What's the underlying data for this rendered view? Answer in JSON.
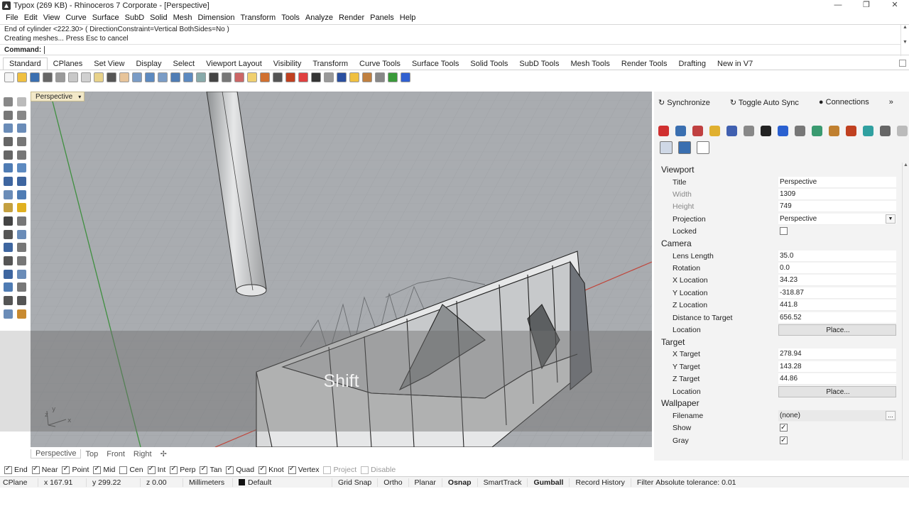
{
  "window": {
    "title": "Typox (269 KB) - Rhinoceros 7 Corporate - [Perspective]",
    "controls": [
      "—",
      "❐",
      "✕"
    ]
  },
  "menu": [
    "File",
    "Edit",
    "View",
    "Curve",
    "Surface",
    "SubD",
    "Solid",
    "Mesh",
    "Dimension",
    "Transform",
    "Tools",
    "Analyze",
    "Render",
    "Panels",
    "Help"
  ],
  "command": {
    "history": [
      "End of cylinder <222.30> ( DirectionConstraint=Vertical  BothSides=No )",
      "Creating meshes... Press Esc to cancel"
    ],
    "prompt_label": "Command:",
    "value": ""
  },
  "toolbar_tabs": [
    "Standard",
    "CPlanes",
    "Set View",
    "Display",
    "Select",
    "Viewport Layout",
    "Visibility",
    "Transform",
    "Curve Tools",
    "Surface Tools",
    "Solid Tools",
    "SubD Tools",
    "Mesh Tools",
    "Render Tools",
    "Drafting",
    "New in V7"
  ],
  "active_toolbar_tab": "Standard",
  "toolbar_icons": {
    "names": [
      "new-icon",
      "open-icon",
      "save-icon",
      "print-icon",
      "import-icon",
      "cut-icon",
      "copy-icon",
      "paste-icon",
      "undo-icon",
      "pan-icon",
      "move-view-icon",
      "zoom-window-icon",
      "zoom-dynamic-icon",
      "zoom-extents-icon",
      "zoom-selected-icon",
      "rotate-view-icon",
      "four-viewports-icon",
      "grid-icon",
      "cplane-icon",
      "bulb-icon",
      "layers-icon",
      "lock-icon",
      "material-icon",
      "color-wheel-icon",
      "shaded-icon",
      "ghosted-icon",
      "rendered-icon",
      "light-icon",
      "settings-icon",
      "macro-icon",
      "web-icon",
      "help-icon"
    ],
    "colors": [
      "#f4f4f4",
      "#f0c040",
      "#3a6fb0",
      "#666",
      "#9a9a9a",
      "#c8c8c8",
      "#d0d0d0",
      "#e8d28a",
      "#555",
      "#e7c49a",
      "#7a9cc6",
      "#5d8ac0",
      "#7a9cc6",
      "#4f7cb4",
      "#5d8ac0",
      "#8aa",
      "#444",
      "#777",
      "#c66",
      "#f0d070",
      "#d07030",
      "#555",
      "#c04020",
      "#e04040",
      "#333",
      "#999",
      "#2a4fa0",
      "#f0c040",
      "#c08040",
      "#888",
      "#3a9a3a",
      "#3060d0"
    ]
  },
  "left_toolbar": {
    "names": [
      "select-icon",
      "point-icon",
      "line-icon",
      "polyline-icon",
      "circle-icon",
      "ellipse-icon",
      "arc-icon",
      "rectangle-icon",
      "polygon-icon",
      "curve-icon",
      "surface-icon",
      "surface-edge-icon",
      "solid-box-icon",
      "solid-sphere-icon",
      "cylinder-icon",
      "extrude-icon",
      "boolean-icon",
      "fillet-icon",
      "trim-icon",
      "split-icon",
      "mesh-icon",
      "sweep-icon",
      "text-icon",
      "dimension-icon",
      "array-icon",
      "mirror-icon",
      "block-icon",
      "group-icon",
      "grid-points-icon",
      "analyze-icon",
      "transform-icon",
      "check-icon",
      "render-icon",
      "paint-icon"
    ],
    "colors": [
      "#888",
      "#bbb",
      "#777",
      "#888",
      "#6a8cb8",
      "#6a8cb8",
      "#666",
      "#777",
      "#666",
      "#777",
      "#4f7cb4",
      "#5d8ac0",
      "#3e66a0",
      "#3e66a0",
      "#6a8cb8",
      "#4f7cb4",
      "#c4a040",
      "#e0b020",
      "#444",
      "#777",
      "#555",
      "#6a8cb8",
      "#3e66a0",
      "#777",
      "#555",
      "#777",
      "#3e66a0",
      "#6a8cb8",
      "#4f7cb4",
      "#777",
      "#555",
      "#555",
      "#6a8cb8",
      "#c88a30"
    ]
  },
  "viewport": {
    "name": "Perspective",
    "dropdown": "▾",
    "overlay_text": "Shift",
    "axis": {
      "y": "y",
      "x": "x",
      "z": "z"
    }
  },
  "viewport_tabs": [
    "Perspective",
    "Top",
    "Front",
    "Right"
  ],
  "viewport_tab_add": "✢",
  "osnaps": [
    {
      "label": "End",
      "checked": true,
      "enabled": true
    },
    {
      "label": "Near",
      "checked": true,
      "enabled": true
    },
    {
      "label": "Point",
      "checked": true,
      "enabled": true
    },
    {
      "label": "Mid",
      "checked": true,
      "enabled": true
    },
    {
      "label": "Cen",
      "checked": false,
      "enabled": true
    },
    {
      "label": "Int",
      "checked": true,
      "enabled": true
    },
    {
      "label": "Perp",
      "checked": true,
      "enabled": true
    },
    {
      "label": "Tan",
      "checked": true,
      "enabled": true
    },
    {
      "label": "Quad",
      "checked": true,
      "enabled": true
    },
    {
      "label": "Knot",
      "checked": true,
      "enabled": true
    },
    {
      "label": "Vertex",
      "checked": true,
      "enabled": true
    },
    {
      "label": "Project",
      "checked": false,
      "enabled": false
    },
    {
      "label": "Disable",
      "checked": false,
      "enabled": false
    }
  ],
  "statusbar": {
    "cplane": "CPlane",
    "x": "x 167.91",
    "y": "y 299.22",
    "z": "z 0.00",
    "units": "Millimeters",
    "layer": "Default",
    "grid_snap": "Grid Snap",
    "ortho": "Ortho",
    "planar": "Planar",
    "osnap": "Osnap",
    "smarttrack": "SmartTrack",
    "gumball": "Gumball",
    "record_history": "Record History",
    "filter": "Filter",
    "tolerance": "Absolute tolerance: 0.01"
  },
  "panel": {
    "top_buttons": [
      "Synchronize",
      "Toggle Auto Sync",
      "Connections",
      "»"
    ],
    "icon_names": [
      "color-icon",
      "object-icon",
      "pencil-icon",
      "folder-icon",
      "display-icon",
      "document-icon",
      "graduate-icon",
      "bell-icon",
      "sun-icon",
      "image-icon",
      "snap-icon",
      "layers-panel-icon",
      "environment-icon",
      "file-icon",
      "more-icon"
    ],
    "icon_colors": [
      "#d03030",
      "#3a6fb0",
      "#c04040",
      "#e0b030",
      "#4060b0",
      "#888",
      "#222",
      "#2a60d0",
      "#777",
      "#3a9a70",
      "#c08030",
      "#c04020",
      "#30a0a0",
      "#666",
      "#bbb"
    ],
    "icon_names2": [
      "camera-icon",
      "settings-icon",
      "frame-icon"
    ],
    "sections": {
      "viewport": {
        "heading": "Viewport",
        "title_label": "Title",
        "title_value": "Perspective",
        "width_label": "Width",
        "width_value": "1309",
        "height_label": "Height",
        "height_value": "749",
        "projection_label": "Projection",
        "projection_value": "Perspective",
        "locked_label": "Locked",
        "locked_checked": false
      },
      "camera": {
        "heading": "Camera",
        "lens_label": "Lens Length",
        "lens_value": "35.0",
        "rotation_label": "Rotation",
        "rotation_value": "0.0",
        "xloc_label": "X Location",
        "xloc_value": "34.23",
        "yloc_label": "Y Location",
        "yloc_value": "-318.87",
        "zloc_label": "Z Location",
        "zloc_value": "441.8",
        "dist_label": "Distance to Target",
        "dist_value": "656.52",
        "location_label": "Location",
        "place_label": "Place..."
      },
      "target": {
        "heading": "Target",
        "xt_label": "X Target",
        "xt_value": "278.94",
        "yt_label": "Y Target",
        "yt_value": "143.28",
        "zt_label": "Z Target",
        "zt_value": "44.86",
        "location_label": "Location",
        "place_label": "Place..."
      },
      "wallpaper": {
        "heading": "Wallpaper",
        "filename_label": "Filename",
        "filename_value": "(none)",
        "show_label": "Show",
        "show_checked": true,
        "gray_label": "Gray",
        "gray_checked": true
      }
    }
  },
  "colors": {
    "viewport_bg": "#a9acb0",
    "viewport_title_bg": "#f2e8c8",
    "x_axis": "#c0453a",
    "y_axis": "#3f8f3f"
  }
}
